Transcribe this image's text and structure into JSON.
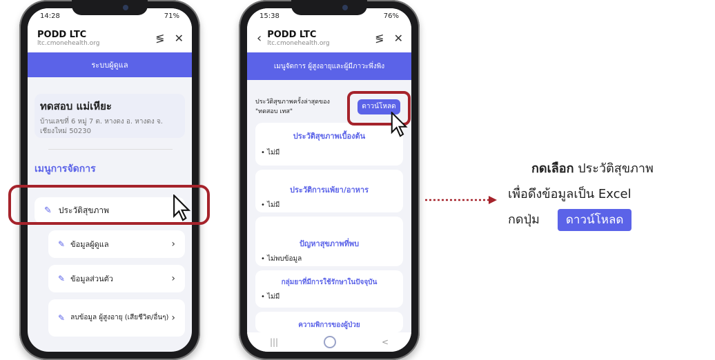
{
  "phone1": {
    "status_time": "14:28",
    "status_right": "71%",
    "browser_title": "PODD LTC",
    "browser_url": "ltc.cmonehealth.org",
    "banner": "ระบบผู้ดูแล",
    "profile_name": "ทดสอบ แม่เหียะ",
    "profile_address": "บ้านเลขที่ 6 หมู่ 7 ต. หางดง อ. หางดง จ. เชียงใหม่ 50230",
    "menu_heading": "เมนูการจัดการ",
    "menu_items": [
      {
        "label": "ประวัติสุขภาพ"
      },
      {
        "label": "ข้อมูลผู้ดูแล"
      },
      {
        "label": "ข้อมูลส่วนตัว"
      },
      {
        "label": "ลบข้อมูล ผู้สูงอายุ (เสียชีวิต/อื่นๆ)"
      }
    ]
  },
  "phone2": {
    "status_time": "15:38",
    "status_right": "76%",
    "browser_title": "PODD LTC",
    "browser_url": "ltc.cmonehealth.org",
    "banner": "เมนูจัดการ ผู้สูงอายุและผู้มีภาวะพึ่งพิง",
    "history_label": "ประวัติสุขภาพครั้งล่าสุดของ",
    "history_name": "\"ทดสอบ เทส\"",
    "download_button": "ดาวน์โหลด",
    "sections": [
      {
        "title": "ประวัติสุขภาพเบื้องต้น",
        "value": "• ไม่มี"
      },
      {
        "title": "ประวัติการแพ้ยา/อาหาร",
        "value": "• ไม่มี"
      },
      {
        "title": "ปัญหาสุขภาพที่พบ",
        "value": "• ไม่พบข้อมูล"
      },
      {
        "title": "กลุ่มยาที่มีการใช้รักษาในปัจจุบัน",
        "value": "• ไม่มี"
      },
      {
        "title": "ความพิการของผู้ป่วย",
        "value": ""
      }
    ],
    "nav_left": "|||",
    "nav_right": "<"
  },
  "instructions": {
    "line1_bold": "กดเลือก",
    "line1_rest": " ประวัติสุขภาพ",
    "line2": "เพื่อดึงข้อมูลเป็น Excel",
    "line3": "กดปุ่ม",
    "button_label": "ดาวน์โหลด"
  },
  "colors": {
    "accent": "#5b63e8",
    "highlight": "#a5232b",
    "arrow": "#a5232b"
  }
}
